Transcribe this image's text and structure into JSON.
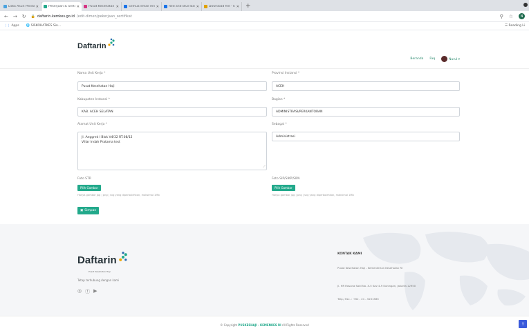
{
  "browser": {
    "tabs": [
      {
        "label": "Data Akun Pendaftar - Dar",
        "color": "#4aa3df"
      },
      {
        "label": "Pekerjaan & Sertifikat - Da",
        "color": "#22a98b",
        "active": true
      },
      {
        "label": "Pusat Kesehatan Haji Kem",
        "color": "#d63384"
      },
      {
        "label": "Semua email Anda - Can",
        "color": "#1a73e8"
      },
      {
        "label": "Red and Blue Basketball Il",
        "color": "#1a73e8"
      },
      {
        "label": "Download file - konversi",
        "color": "#e0a100"
      }
    ],
    "url_host": "daftarin.kemkes.go.id",
    "url_path": "/edit-dimen/pekerjaan_sertifikat",
    "bookmarks": [
      "Apps",
      "SISKOHATKES Sin..."
    ],
    "reading_list": "Reading Li",
    "profile_initial": "N"
  },
  "site": {
    "logo": "Daftarin",
    "nav": {
      "beranda": "Beranda",
      "faq": "Faq",
      "user": "Nurul"
    }
  },
  "form": {
    "nama_unit_kerja": {
      "label": "Nama Unit Kerja *",
      "value": "Pusat Kesehatan Haji"
    },
    "provinsi": {
      "label": "Provinsi Instansi *",
      "value": "ACEH"
    },
    "kabupaten": {
      "label": "Kabupaten Instansi *",
      "value": "KAB. ACEH SELATAN"
    },
    "bagian": {
      "label": "Bagian *",
      "value": "ADMINISTRASI/PERKANTORAN"
    },
    "alamat": {
      "label": "Alamat Unit Kerja *",
      "line1": "Jl. Anggrek I Blok V4/32 RT.08/12",
      "line2": "Villar Indah Pratama test"
    },
    "sebagai": {
      "label": "Sebagai *",
      "value": "Administrasi"
    },
    "foto_str": {
      "label": "Foto STR",
      "button": "Pilih Gambar",
      "hint": "Hanya gambar jpg | png | svg yang diperbolehkan, maksimal 1Mb"
    },
    "foto_sip": {
      "label": "Foto SIP/SIKP/SIPA",
      "button": "Pilih Gambar",
      "hint": "Hanya gambar jpg | png | svg yang diperbolehkan, maksimal 1Mb"
    },
    "save": "Simpan"
  },
  "footer": {
    "logo": "Daftarin",
    "sub": "Pusat Kesehatan Haji",
    "desc": "Tetap terhubung dengan kami",
    "kontak_title": "KONTAK KAMI",
    "kontak_org": "Pusat Kesehatan Haji - Kementerian Kesehatan RI",
    "kontak_addr": "Jl. HR Rasuna Said No. X-5 Kav 4-9 Kuningan, Jakarta 12950",
    "kontak_phone": "Telp./ Fax. : +62 - 21 - 5201585",
    "copyright_pre": "© Copyright",
    "copyright_org": "PUSKESHAJI - KEMENKES RI",
    "copyright_post": "All Rights Reserved"
  }
}
